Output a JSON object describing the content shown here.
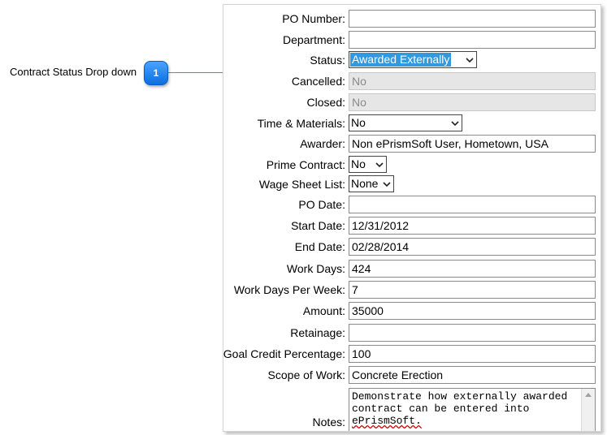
{
  "callout": {
    "label": "Contract Status Drop down",
    "badge": "1"
  },
  "form": {
    "po_number": {
      "label": "PO Number:",
      "value": ""
    },
    "department": {
      "label": "Department:",
      "value": ""
    },
    "status": {
      "label": "Status:",
      "value": "Awarded Externally"
    },
    "cancelled": {
      "label": "Cancelled:",
      "value": "No"
    },
    "closed": {
      "label": "Closed:",
      "value": "No"
    },
    "time_materials": {
      "label": "Time & Materials:",
      "value": "No"
    },
    "awarder": {
      "label": "Awarder:",
      "value": "Non ePrismSoft User, Hometown, USA"
    },
    "prime_contract": {
      "label": "Prime Contract:",
      "value": "No"
    },
    "wage_sheet_list": {
      "label": "Wage Sheet List:",
      "value": "None"
    },
    "po_date": {
      "label": "PO Date:",
      "value": ""
    },
    "start_date": {
      "label": "Start Date:",
      "value": "12/31/2012"
    },
    "end_date": {
      "label": "End Date:",
      "value": "02/28/2014"
    },
    "work_days": {
      "label": "Work Days:",
      "value": "424"
    },
    "work_days_per_week": {
      "label": "Work Days Per Week:",
      "value": "7"
    },
    "amount": {
      "label": "Amount:",
      "value": "35000"
    },
    "retainage": {
      "label": "Retainage:",
      "value": ""
    },
    "goal_credit_percentage": {
      "label": "Goal Credit Percentage:",
      "value": "100"
    },
    "scope_of_work": {
      "label": "Scope of Work:",
      "value": "Concrete Erection"
    },
    "notes": {
      "label": "Notes:",
      "line1": "Demonstrate how externally awarded",
      "line2": "contract can be entered into",
      "line3": "ePrismSoft."
    }
  }
}
